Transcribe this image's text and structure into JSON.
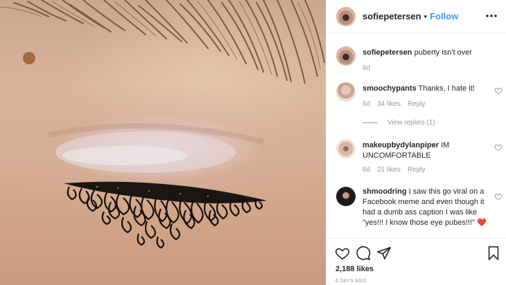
{
  "post": {
    "author": "sofiepetersen",
    "follow_label": "Follow",
    "separator": "•",
    "more_icon": "more-horizontal-icon"
  },
  "caption": {
    "username": "sofiepetersen",
    "text": "puberty isn't over",
    "time": "6d"
  },
  "comments": [
    {
      "username": "smoochypants",
      "text": "Thanks, I hate it!",
      "time": "6d",
      "likes": "34 likes",
      "reply": "Reply",
      "view_replies": "View replies (1)"
    },
    {
      "username": "makeupbydylanpiper",
      "text": "IM UNCOMFORTABLE",
      "time": "6d",
      "likes": "21 likes",
      "reply": "Reply"
    },
    {
      "username": "shmoodring",
      "text": "I saw this go viral on a Facebook meme and even though it had a dumb ass caption I was like \"yes!!! I know those eye pubes!!!\"",
      "emoji": "❤️"
    }
  ],
  "footer": {
    "likes": "2,188 likes",
    "time_ago": "6 DAYS AGO",
    "icons": [
      "heart-icon",
      "comment-icon",
      "share-icon",
      "bookmark-icon"
    ]
  },
  "colors": {
    "link": "#3897f0",
    "muted": "#999999",
    "text": "#262626",
    "heart": "#ed4956"
  }
}
